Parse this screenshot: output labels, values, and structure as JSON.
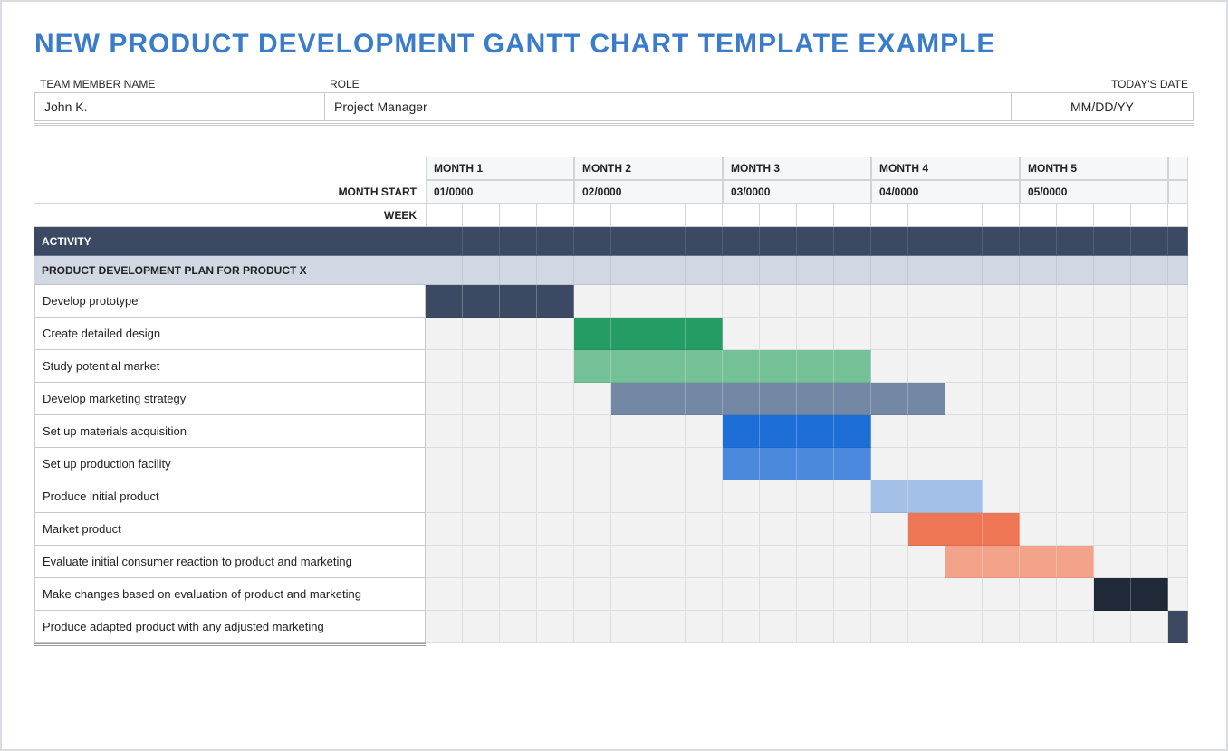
{
  "title": "NEW PRODUCT DEVELOPMENT GANTT CHART TEMPLATE EXAMPLE",
  "labels": {
    "team_member": "TEAM MEMBER NAME",
    "role": "ROLE",
    "today": "TODAY'S DATE",
    "month_start": "MONTH START",
    "week": "WEEK",
    "activity": "ACTIVITY"
  },
  "info": {
    "team_member": "John K.",
    "role": "Project Manager",
    "today": "MM/DD/YY"
  },
  "months": [
    {
      "label": "MONTH 1",
      "start": "01/0000"
    },
    {
      "label": "MONTH 2",
      "start": "02/0000"
    },
    {
      "label": "MONTH 3",
      "start": "03/0000"
    },
    {
      "label": "MONTH 4",
      "start": "04/0000"
    },
    {
      "label": "MONTH 5",
      "start": "05/0000"
    }
  ],
  "weeks_per_month": 4,
  "section": "PRODUCT DEVELOPMENT PLAN FOR PRODUCT X",
  "chart_data": {
    "type": "bar",
    "title": "New Product Development Gantt Chart",
    "xlabel": "Week",
    "ylabel": "Activity",
    "total_weeks": 22,
    "series": [
      {
        "name": "Develop prototype",
        "start": 1,
        "end": 4,
        "color": "#3b4a62"
      },
      {
        "name": "Create detailed design",
        "start": 5,
        "end": 8,
        "color": "#249c63"
      },
      {
        "name": "Study potential market",
        "start": 5,
        "end": 12,
        "color": "#74c197"
      },
      {
        "name": "Develop marketing strategy",
        "start": 6,
        "end": 14,
        "color": "#7288a5"
      },
      {
        "name": "Set up materials acquisition",
        "start": 9,
        "end": 12,
        "color": "#1d6ed6"
      },
      {
        "name": "Set up production facility",
        "start": 9,
        "end": 12,
        "color": "#4a89db"
      },
      {
        "name": "Produce initial product",
        "start": 13,
        "end": 15,
        "color": "#a3c1e8"
      },
      {
        "name": "Market product",
        "start": 14,
        "end": 16,
        "color": "#ef7654"
      },
      {
        "name": "Evaluate initial consumer reaction to product and marketing",
        "start": 15,
        "end": 18,
        "color": "#f3a38a"
      },
      {
        "name": "Make changes based on evaluation of product and marketing",
        "start": 19,
        "end": 20,
        "color": "#1f2938"
      },
      {
        "name": "Produce adapted product with any adjusted marketing",
        "start": 21,
        "end": 22,
        "color": "#3b4a62"
      }
    ]
  }
}
